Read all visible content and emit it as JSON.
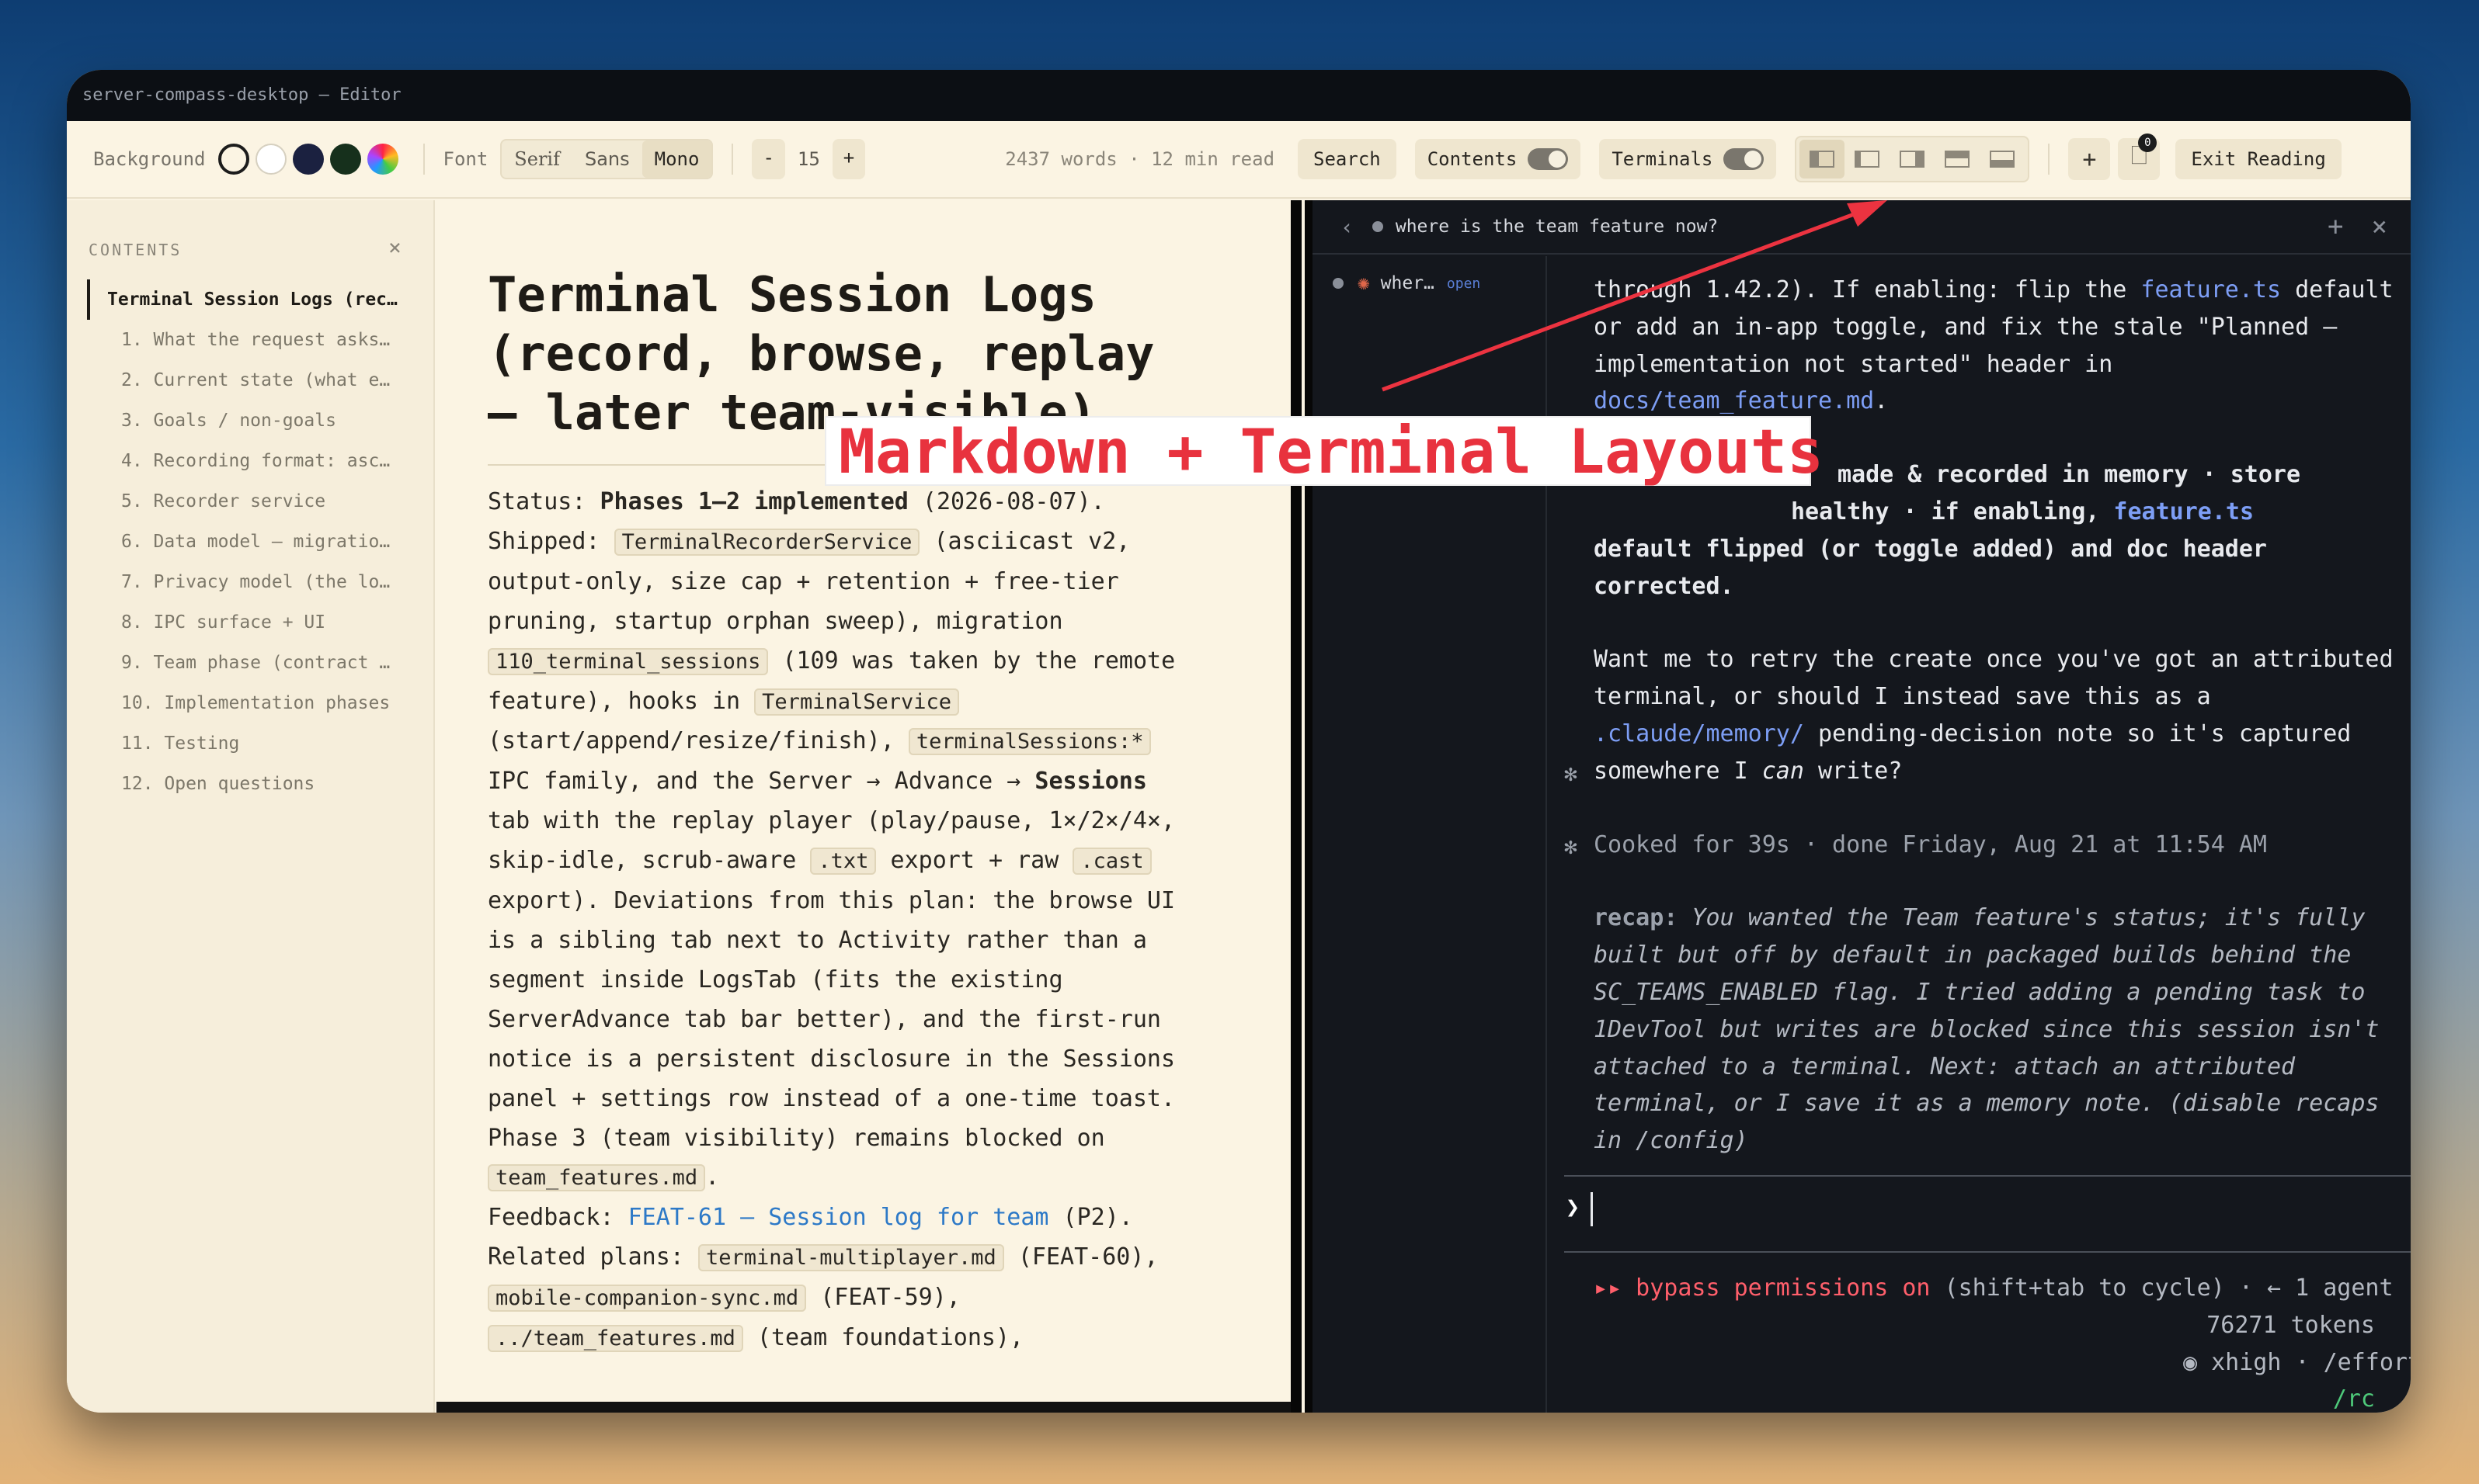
{
  "window": {
    "title": "server-compass-desktop — Editor"
  },
  "toolbar": {
    "background_label": "Background",
    "font_label": "Font",
    "fonts": [
      "Serif",
      "Sans",
      "Mono"
    ],
    "selected_font": "Mono",
    "size_minus": "-",
    "size_value": "15",
    "size_plus": "+",
    "stats": "2437 words · 12 min read",
    "search_label": "Search",
    "contents_label": "Contents",
    "terminals_label": "Terminals",
    "doc_badge": "0",
    "exit_label": "Exit Reading"
  },
  "sidebar": {
    "heading": "CONTENTS",
    "items": [
      "Terminal Session Logs (rec…",
      "1. What the request asks…",
      "2. Current state (what e…",
      "3. Goals / non-goals",
      "4. Recording format: asc…",
      "5. Recorder service",
      "6. Data model — migratio…",
      "7. Privacy model (the lo…",
      "8. IPC surface + UI",
      "9. Team phase (contract …",
      "10. Implementation phases",
      "11. Testing",
      "12. Open questions"
    ]
  },
  "doc": {
    "title_l1": "Terminal Session Logs",
    "title_l2": "(record, browse, replay",
    "title_l3": "— later team-visible)",
    "status_label": "Status:",
    "status_value": "Phases 1–2 implemented",
    "status_date": "(2026-08-07).",
    "shipped_label": "Shipped:",
    "code_recorder": "TerminalRecorderService",
    "t1": "(asciicast v2, output-only, size cap + retention + free-tier pruning, startup orphan sweep), migration",
    "code_migration": "110_terminal_sessions",
    "t2": "(109 was taken by the remote feature), hooks in",
    "code_terminal": "TerminalService",
    "t3": "(start/append/resize/finish),",
    "code_ipc": "terminalSessions:*",
    "t4": "IPC family, and the Server → Advance →",
    "sessions_bold": "Sessions",
    "t5": "tab with the replay player (play/pause, 1×/2×/4×, skip-idle, scrub-aware",
    "code_txt": ".txt",
    "t6": "export + raw",
    "code_cast": ".cast",
    "t7": "export). Deviations from this plan: the browse UI is a sibling tab next to Activity rather than a segment inside LogsTab (fits the existing ServerAdvance tab bar better), and the first-run notice is a persistent disclosure in the Sessions panel + settings row instead of a one-time toast. Phase 3 (team visibility) remains blocked on",
    "code_team": "team_features.md",
    "t8": ".",
    "feedback_label": "Feedback:",
    "feedback_link": "FEAT-61 — Session log for team",
    "feedback_tail": "(P2).",
    "related_label": "Related plans:",
    "code_multi": "terminal-multiplayer.md",
    "related_1": "(FEAT-60),",
    "code_mobile": "mobile-companion-sync.md",
    "related_2": "(FEAT-59),",
    "code_teamf": "../team_features.md",
    "related_3": "(team foundations),"
  },
  "terminal": {
    "tab_title": "where is the team feature now?",
    "session_name": "wher…",
    "session_state": "open",
    "p1_a": "through 1.42.2). If enabling: flip the",
    "p1_link1": "feature.ts",
    "p1_b": "default or add an in-app toggle, and fix the stale \"Planned — implementation not started\" header in",
    "p1_link2": "docs/team_feature.md",
    "p1_c": ".",
    "p2_a": "made & recorded in memory · store",
    "p2_b": "healthy · if enabling,",
    "p2_link": "feature.ts",
    "p2_c": "default flipped (or toggle added) and doc header corrected.",
    "p3_a": "Want me to retry the create once you've got an attributed terminal, or should I instead save this as a",
    "p3_link": ".claude/memory/",
    "p3_b": "pending-decision note so it's captured somewhere I",
    "p3_can": "can",
    "p3_c": "write?",
    "cooked": "Cooked for 39s · done Friday, Aug 21 at 11:54 AM",
    "recap_label": "recap:",
    "recap_text": "You wanted the Team feature's status; it's fully built but off by default in packaged builds behind the SC_TEAMS_ENABLED flag. I tried adding a pending task to 1DevTool but writes are blocked since this session isn't attached to a terminal. Next: attach an attributed terminal, or I save it as a memory note. (disable recaps in /config)",
    "prompt_char": "❯",
    "status_red": "▸▸ bypass permissions on",
    "status_rest": "(shift+tab to cycle) · ← 1 agent",
    "tokens": "76271 tokens",
    "effort": "◉ xhigh · /effort",
    "rc": "/rc"
  },
  "overlay": {
    "banner": "Markdown + Terminal Layouts"
  },
  "colors": {
    "accent_red": "#e8323e",
    "link_blue": "#2d79c7",
    "terminal_bg": "#14171d",
    "paper_bg": "#fbf4e3"
  }
}
